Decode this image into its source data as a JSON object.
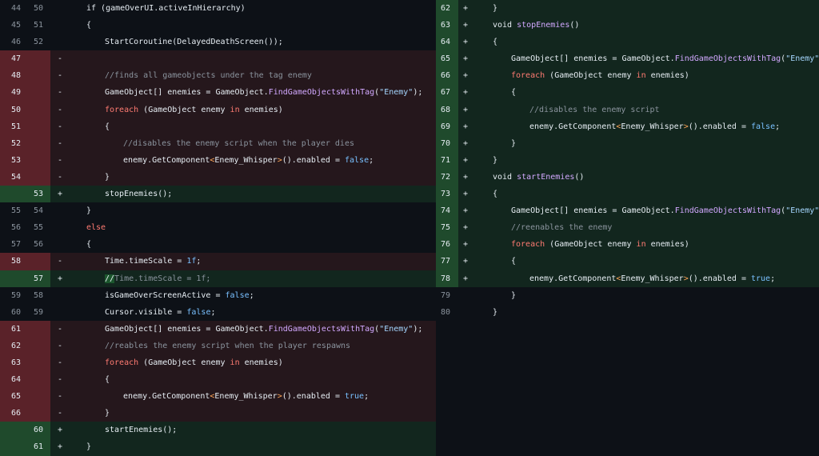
{
  "left_rows": [
    {
      "type": "ctx",
      "old": "44",
      "new": "50",
      "marker": "",
      "indent": 4,
      "tokens": [
        {
          "t": "if (gameOverUI.activeInHierarchy)",
          "c": "kw-if"
        }
      ]
    },
    {
      "type": "ctx",
      "old": "45",
      "new": "51",
      "marker": "",
      "indent": 4,
      "tokens": [
        {
          "t": "{"
        }
      ]
    },
    {
      "type": "ctx",
      "old": "46",
      "new": "52",
      "marker": "",
      "indent": 8,
      "tokens": [
        {
          "t": "StartCoroutine(DelayedDeathScreen());"
        }
      ]
    },
    {
      "type": "del",
      "old": "47",
      "new": "",
      "marker": "-",
      "indent": 0,
      "tokens": []
    },
    {
      "type": "del",
      "old": "48",
      "new": "",
      "marker": "-",
      "indent": 8,
      "tokens": [
        {
          "t": "//finds all gameobjects under the tag enemy",
          "c": "cm"
        }
      ]
    },
    {
      "type": "del",
      "old": "49",
      "new": "",
      "marker": "-",
      "indent": 8,
      "tokens": [
        {
          "t": "GameObject[] enemies = GameObject."
        },
        {
          "t": "FindGameObjectsWithTag",
          "c": "fn"
        },
        {
          "t": "("
        },
        {
          "t": "\"Enemy\"",
          "c": "str"
        },
        {
          "t": ");"
        }
      ]
    },
    {
      "type": "del",
      "old": "50",
      "new": "",
      "marker": "-",
      "indent": 8,
      "tokens": [
        {
          "t": "foreach",
          "c": "kw"
        },
        {
          "t": " (GameObject enemy "
        },
        {
          "t": "in",
          "c": "kw"
        },
        {
          "t": " enemies)"
        }
      ]
    },
    {
      "type": "del",
      "old": "51",
      "new": "",
      "marker": "-",
      "indent": 8,
      "tokens": [
        {
          "t": "{"
        }
      ]
    },
    {
      "type": "del",
      "old": "52",
      "new": "",
      "marker": "-",
      "indent": 12,
      "tokens": [
        {
          "t": "//disables the enemy script when the player dies",
          "c": "cm"
        }
      ]
    },
    {
      "type": "del",
      "old": "53",
      "new": "",
      "marker": "-",
      "indent": 12,
      "tokens": [
        {
          "t": "enemy.GetComponent"
        },
        {
          "t": "<",
          "c": "typ"
        },
        {
          "t": "Enemy_Whisper"
        },
        {
          "t": ">",
          "c": "typ"
        },
        {
          "t": "().enabled = "
        },
        {
          "t": "false",
          "c": "lit"
        },
        {
          "t": ";"
        }
      ]
    },
    {
      "type": "del",
      "old": "54",
      "new": "",
      "marker": "-",
      "indent": 8,
      "tokens": [
        {
          "t": "}"
        }
      ]
    },
    {
      "type": "add",
      "old": "",
      "new": "53",
      "marker": "+",
      "indent": 8,
      "tokens": [
        {
          "t": "stopEnemies();"
        }
      ]
    },
    {
      "type": "ctx",
      "old": "55",
      "new": "54",
      "marker": "",
      "indent": 4,
      "tokens": [
        {
          "t": "}"
        }
      ]
    },
    {
      "type": "ctx",
      "old": "56",
      "new": "55",
      "marker": "",
      "indent": 4,
      "tokens": [
        {
          "t": "else",
          "c": "kw"
        }
      ]
    },
    {
      "type": "ctx",
      "old": "57",
      "new": "56",
      "marker": "",
      "indent": 4,
      "tokens": [
        {
          "t": "{"
        }
      ]
    },
    {
      "type": "del",
      "old": "58",
      "new": "",
      "marker": "-",
      "indent": 8,
      "tokens": [
        {
          "t": "Time.timeScale = "
        },
        {
          "t": "1f",
          "c": "lit"
        },
        {
          "t": ";"
        }
      ]
    },
    {
      "type": "add",
      "old": "",
      "new": "57",
      "marker": "+",
      "indent": 8,
      "tokens": [
        {
          "t": "//",
          "c": "hl"
        },
        {
          "t": "Time.timeScale = 1f;",
          "c": "cm"
        }
      ]
    },
    {
      "type": "ctx",
      "old": "59",
      "new": "58",
      "marker": "",
      "indent": 8,
      "tokens": [
        {
          "t": "isGameOverScreenActive = "
        },
        {
          "t": "false",
          "c": "lit"
        },
        {
          "t": ";"
        }
      ]
    },
    {
      "type": "ctx",
      "old": "60",
      "new": "59",
      "marker": "",
      "indent": 8,
      "tokens": [
        {
          "t": "Cursor.visible = "
        },
        {
          "t": "false",
          "c": "lit"
        },
        {
          "t": ";"
        }
      ]
    },
    {
      "type": "del",
      "old": "61",
      "new": "",
      "marker": "-",
      "indent": 8,
      "tokens": [
        {
          "t": "GameObject[] enemies = GameObject."
        },
        {
          "t": "FindGameObjectsWithTag",
          "c": "fn"
        },
        {
          "t": "("
        },
        {
          "t": "\"Enemy\"",
          "c": "str"
        },
        {
          "t": ");"
        }
      ]
    },
    {
      "type": "del",
      "old": "62",
      "new": "",
      "marker": "-",
      "indent": 8,
      "tokens": [
        {
          "t": "//reables the enemy script when the player respawns",
          "c": "cm"
        }
      ]
    },
    {
      "type": "del",
      "old": "63",
      "new": "",
      "marker": "-",
      "indent": 8,
      "tokens": [
        {
          "t": "foreach",
          "c": "kw"
        },
        {
          "t": " (GameObject enemy "
        },
        {
          "t": "in",
          "c": "kw"
        },
        {
          "t": " enemies)"
        }
      ]
    },
    {
      "type": "del",
      "old": "64",
      "new": "",
      "marker": "-",
      "indent": 8,
      "tokens": [
        {
          "t": "{"
        }
      ]
    },
    {
      "type": "del",
      "old": "65",
      "new": "",
      "marker": "-",
      "indent": 12,
      "tokens": [
        {
          "t": "enemy.GetComponent"
        },
        {
          "t": "<",
          "c": "typ"
        },
        {
          "t": "Enemy_Whisper"
        },
        {
          "t": ">",
          "c": "typ"
        },
        {
          "t": "().enabled = "
        },
        {
          "t": "true",
          "c": "lit"
        },
        {
          "t": ";"
        }
      ]
    },
    {
      "type": "del",
      "old": "66",
      "new": "",
      "marker": "-",
      "indent": 8,
      "tokens": [
        {
          "t": "}"
        }
      ]
    },
    {
      "type": "add",
      "old": "",
      "new": "60",
      "marker": "+",
      "indent": 8,
      "tokens": [
        {
          "t": "startEnemies();"
        }
      ]
    },
    {
      "type": "add",
      "old": "",
      "new": "61",
      "marker": "+",
      "indent": 4,
      "tokens": [
        {
          "t": "}"
        }
      ]
    }
  ],
  "right_rows": [
    {
      "type": "add",
      "new": "62",
      "marker": "+",
      "indent": 4,
      "tokens": [
        {
          "t": "}"
        }
      ]
    },
    {
      "type": "add",
      "new": "63",
      "marker": "+",
      "indent": 4,
      "tokens": [
        {
          "t": "void "
        },
        {
          "t": "stopEnemies",
          "c": "fn"
        },
        {
          "t": "()"
        }
      ]
    },
    {
      "type": "add",
      "new": "64",
      "marker": "+",
      "indent": 4,
      "tokens": [
        {
          "t": "{"
        }
      ]
    },
    {
      "type": "add",
      "new": "65",
      "marker": "+",
      "indent": 8,
      "tokens": [
        {
          "t": "GameObject[] enemies = GameObject."
        },
        {
          "t": "FindGameObjectsWithTag",
          "c": "fn"
        },
        {
          "t": "("
        },
        {
          "t": "\"Enemy\"",
          "c": "str"
        },
        {
          "t": ");"
        }
      ]
    },
    {
      "type": "add",
      "new": "66",
      "marker": "+",
      "indent": 8,
      "tokens": [
        {
          "t": "foreach",
          "c": "kw"
        },
        {
          "t": " (GameObject enemy "
        },
        {
          "t": "in",
          "c": "kw"
        },
        {
          "t": " enemies)"
        }
      ]
    },
    {
      "type": "add",
      "new": "67",
      "marker": "+",
      "indent": 8,
      "tokens": [
        {
          "t": "{"
        }
      ]
    },
    {
      "type": "add",
      "new": "68",
      "marker": "+",
      "indent": 12,
      "tokens": [
        {
          "t": "//disables the enemy script",
          "c": "cm"
        }
      ]
    },
    {
      "type": "add",
      "new": "69",
      "marker": "+",
      "indent": 12,
      "tokens": [
        {
          "t": "enemy.GetComponent"
        },
        {
          "t": "<",
          "c": "typ"
        },
        {
          "t": "Enemy_Whisper"
        },
        {
          "t": ">",
          "c": "typ"
        },
        {
          "t": "().enabled = "
        },
        {
          "t": "false",
          "c": "lit"
        },
        {
          "t": ";"
        }
      ]
    },
    {
      "type": "add",
      "new": "70",
      "marker": "+",
      "indent": 8,
      "tokens": [
        {
          "t": "}"
        }
      ]
    },
    {
      "type": "add",
      "new": "71",
      "marker": "+",
      "indent": 4,
      "tokens": [
        {
          "t": "}"
        }
      ]
    },
    {
      "type": "add",
      "new": "72",
      "marker": "+",
      "indent": 4,
      "tokens": [
        {
          "t": "void "
        },
        {
          "t": "startEnemies",
          "c": "fn"
        },
        {
          "t": "()"
        }
      ]
    },
    {
      "type": "add",
      "new": "73",
      "marker": "+",
      "indent": 4,
      "tokens": [
        {
          "t": "{"
        }
      ]
    },
    {
      "type": "add",
      "new": "74",
      "marker": "+",
      "indent": 8,
      "tokens": [
        {
          "t": "GameObject[] enemies = GameObject."
        },
        {
          "t": "FindGameObjectsWithTag",
          "c": "fn"
        },
        {
          "t": "("
        },
        {
          "t": "\"Enemy\"",
          "c": "str"
        },
        {
          "t": ");"
        }
      ]
    },
    {
      "type": "add",
      "new": "75",
      "marker": "+",
      "indent": 8,
      "tokens": [
        {
          "t": "//reenables the enemy",
          "c": "cm"
        }
      ]
    },
    {
      "type": "add",
      "new": "76",
      "marker": "+",
      "indent": 8,
      "tokens": [
        {
          "t": "foreach",
          "c": "kw"
        },
        {
          "t": " (GameObject enemy "
        },
        {
          "t": "in",
          "c": "kw"
        },
        {
          "t": " enemies)"
        }
      ]
    },
    {
      "type": "add",
      "new": "77",
      "marker": "+",
      "indent": 8,
      "tokens": [
        {
          "t": "{"
        }
      ]
    },
    {
      "type": "add",
      "new": "78",
      "marker": "+",
      "indent": 12,
      "tokens": [
        {
          "t": "enemy.GetComponent"
        },
        {
          "t": "<",
          "c": "typ"
        },
        {
          "t": "Enemy_Whisper"
        },
        {
          "t": ">",
          "c": "typ"
        },
        {
          "t": "().enabled = "
        },
        {
          "t": "true",
          "c": "lit"
        },
        {
          "t": ";"
        }
      ]
    },
    {
      "type": "ctx",
      "new": "79",
      "marker": "",
      "indent": 8,
      "tokens": [
        {
          "t": "}"
        }
      ]
    },
    {
      "type": "ctx",
      "new": "80",
      "marker": "",
      "indent": 4,
      "tokens": [
        {
          "t": "}"
        }
      ]
    }
  ],
  "colors": {
    "added_gutter": "#1f4a2c",
    "deleted_gutter": "#5a2229",
    "added_bg": "#12261e",
    "deleted_bg": "#25171c",
    "background": "#0d1117"
  }
}
